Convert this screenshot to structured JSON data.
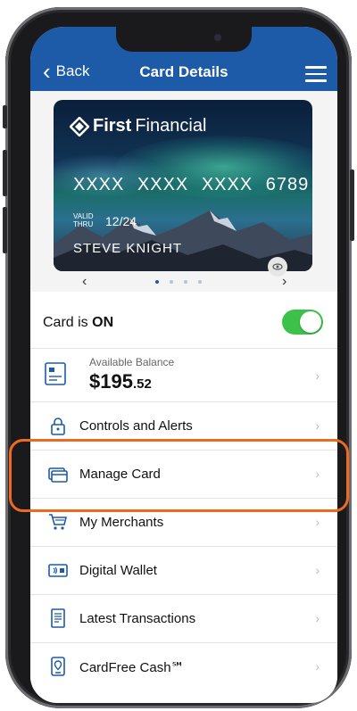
{
  "header": {
    "back_label": "Back",
    "title": "Card Details"
  },
  "card": {
    "brand_bold": "First",
    "brand_light": "Financial",
    "number": "XXXX XXXX XXXX 6789",
    "valid_label": "VALID THRU",
    "expiry": "12/24",
    "holder": "STEVE KNIGHT"
  },
  "carousel": {
    "prev": "‹",
    "next": "›",
    "page_count": 4,
    "active_page": 1
  },
  "card_status": {
    "prefix": "Card is ",
    "state": "ON",
    "enabled": true
  },
  "balance": {
    "caption": "Available Balance",
    "whole": "$195",
    "cents": ".52"
  },
  "menu_items": [
    {
      "label": "Controls and Alerts",
      "icon": "lock-icon"
    },
    {
      "label": "Manage Card",
      "icon": "card-icon"
    },
    {
      "label": "My Merchants",
      "icon": "cart-icon"
    },
    {
      "label": "Digital Wallet",
      "icon": "wallet-icon"
    },
    {
      "label": "Latest Transactions",
      "icon": "receipt-icon"
    },
    {
      "label": "CardFree Cash℠",
      "icon": "location-pin-icon"
    }
  ],
  "colors": {
    "header": "#1d5aa8",
    "toggle_on": "#3cc24a",
    "highlight": "#ee6a1f",
    "icon": "#1d5aa8"
  }
}
